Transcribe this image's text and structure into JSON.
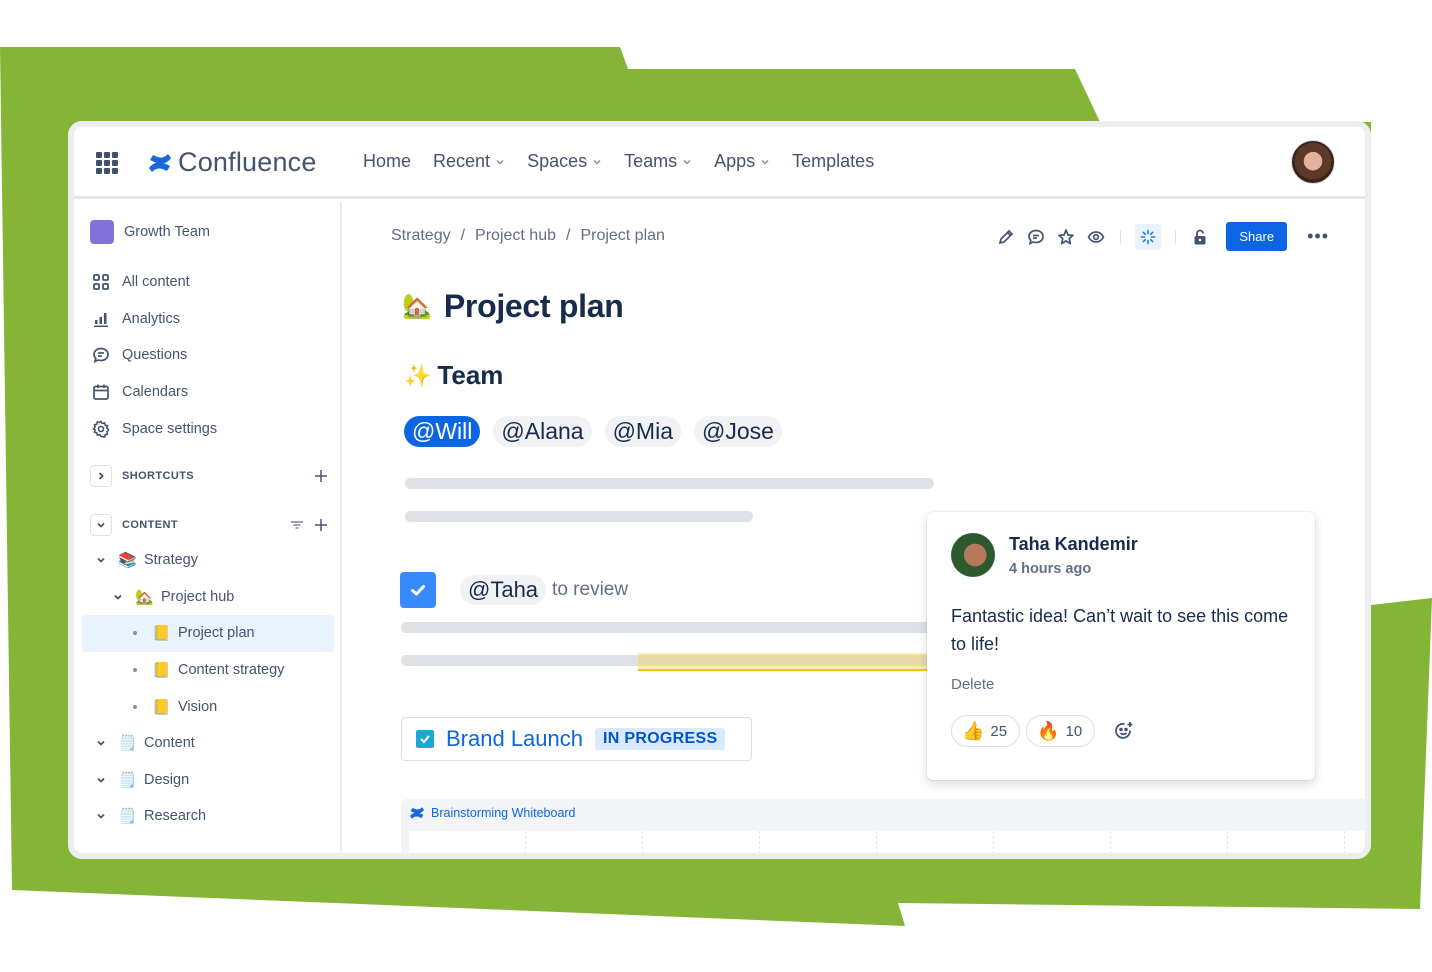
{
  "theme": {
    "brand": "#0c66e4",
    "background_accent": "#84b537",
    "space_color": "#8270db"
  },
  "topnav": {
    "product": "Confluence",
    "items": [
      {
        "label": "Home",
        "dropdown": false
      },
      {
        "label": "Recent",
        "dropdown": true
      },
      {
        "label": "Spaces",
        "dropdown": true
      },
      {
        "label": "Teams",
        "dropdown": true
      },
      {
        "label": "Apps",
        "dropdown": true
      },
      {
        "label": "Templates",
        "dropdown": false
      }
    ]
  },
  "sidebar": {
    "space_name": "Growth Team",
    "menu": [
      {
        "label": "All content",
        "icon": "grid-icon"
      },
      {
        "label": "Analytics",
        "icon": "bar-chart-icon"
      },
      {
        "label": "Questions",
        "icon": "speech-bubble-icon"
      },
      {
        "label": "Calendars",
        "icon": "calendar-icon"
      },
      {
        "label": "Space settings",
        "icon": "gear-icon"
      }
    ],
    "shortcuts_label": "SHORTCUTS",
    "content_label": "CONTENT",
    "tree": [
      {
        "label": "Strategy",
        "emoji": "📚",
        "level": 0,
        "expanded": true
      },
      {
        "label": "Project hub",
        "emoji": "🏡",
        "level": 1,
        "expanded": true
      },
      {
        "label": "Project plan",
        "emoji": "📒",
        "level": 2,
        "selected": true
      },
      {
        "label": "Content strategy",
        "emoji": "📒",
        "level": 2
      },
      {
        "label": "Vision",
        "emoji": "📒",
        "level": 2
      },
      {
        "label": "Content",
        "emoji": "🗒️",
        "level": 0,
        "expanded": true
      },
      {
        "label": "Design",
        "emoji": "🗒️",
        "level": 0,
        "expanded": true
      },
      {
        "label": "Research",
        "emoji": "🗒️",
        "level": 0,
        "expanded": true
      }
    ]
  },
  "main": {
    "breadcrumb": [
      "Strategy",
      "Project hub",
      "Project plan"
    ],
    "breadcrumb_separator": "/",
    "share_label": "Share",
    "more_label": "•••",
    "title_emoji": "🏡",
    "title": "Project plan",
    "team_emoji": "✨",
    "team_heading": "Team",
    "mentions": [
      "@Will",
      "@Alana",
      "@Mia",
      "@Jose"
    ],
    "task": {
      "checked": true,
      "mention": "@Taha",
      "text": "to review"
    },
    "jira": {
      "title": "Brand Launch",
      "status": "IN PROGRESS"
    },
    "whiteboard_title": "Brainstorming Whiteboard"
  },
  "comment": {
    "author": "Taha Kandemir",
    "time": "4 hours ago",
    "body": "Fantastic idea! Can’t wait to see this come to life!",
    "delete_label": "Delete",
    "reactions": [
      {
        "emoji": "👍",
        "count": "25"
      },
      {
        "emoji": "🔥",
        "count": "10"
      }
    ]
  }
}
